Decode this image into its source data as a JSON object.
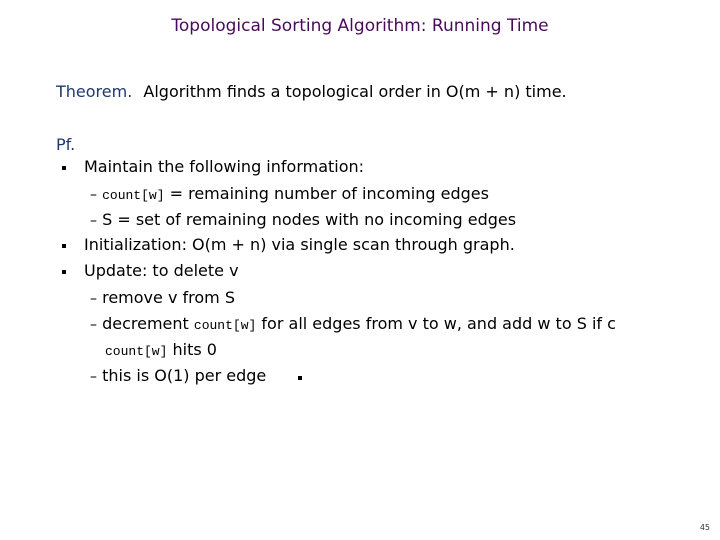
{
  "slide": {
    "title": "Topological Sorting Algorithm: Running Time",
    "theorem": {
      "label": "Theorem.",
      "text": "Algorithm finds a topological order in O(m + n) time."
    },
    "proof_label": "Pf.",
    "bullets": [
      {
        "text": "Maintain the following information:",
        "sub": [
          {
            "code": "count[w]",
            "text": "= remaining number of incoming edges"
          },
          {
            "text": "S = set of remaining nodes with no incoming edges"
          }
        ]
      },
      {
        "text": "Initialization: O(m + n) via single scan through graph."
      },
      {
        "text": "Update: to delete v",
        "sub": [
          {
            "text": "remove v from S"
          },
          {
            "pre": "decrement",
            "code": "count[w]",
            "text": "for all edges from v to w, and add w to S if c",
            "cont_code": "count[w]",
            "cont_text": "hits 0"
          },
          {
            "text": "this is O(1) per edge"
          }
        ]
      }
    ],
    "page_number": "45"
  }
}
